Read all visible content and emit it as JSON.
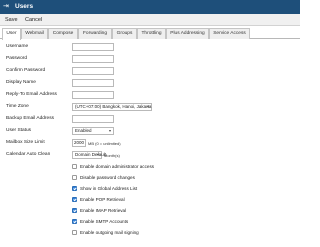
{
  "window": {
    "title": "Users",
    "icon": "collapse-panel-icon"
  },
  "toolbar": {
    "save_label": "Save",
    "cancel_label": "Cancel"
  },
  "tabs": [
    {
      "label": "User",
      "active": true
    },
    {
      "label": "Webmail"
    },
    {
      "label": "Compose"
    },
    {
      "label": "Forwarding"
    },
    {
      "label": "Groups"
    },
    {
      "label": "Throttling"
    },
    {
      "label": "Plus Addressing"
    },
    {
      "label": "Service Access"
    }
  ],
  "form": {
    "username": {
      "label": "Username",
      "value": ""
    },
    "password": {
      "label": "Password",
      "value": ""
    },
    "confirm_password": {
      "label": "Confirm Password",
      "value": ""
    },
    "display_name": {
      "label": "Display Name",
      "value": ""
    },
    "reply_to": {
      "label": "Reply-To Email Address",
      "value": ""
    },
    "time_zone": {
      "label": "Time Zone",
      "value": "(UTC+07:00) Bangkok, Hanoi, Jakarta"
    },
    "backup_email": {
      "label": "Backup Email Address",
      "value": ""
    },
    "user_status": {
      "label": "User Status",
      "value": "Enabled"
    },
    "mailbox_size": {
      "label": "Mailbox Size Limit",
      "value": "2000",
      "unit_hint": "MB  (0 = unlimited)"
    },
    "calendar_clean": {
      "label": "Calendar Auto Clean",
      "value": "Domain Default",
      "unit": "Month(s)"
    }
  },
  "options": [
    {
      "label": "Enable domain administrator access",
      "checked": false
    },
    {
      "label": "Disable password changes",
      "checked": false
    },
    {
      "label": "Show in Global Address List",
      "checked": true
    },
    {
      "label": "Enable POP Retrieval",
      "checked": true
    },
    {
      "label": "Enable IMAP Retrieval",
      "checked": true
    },
    {
      "label": "Enable SMTP Accounts",
      "checked": true
    },
    {
      "label": "Enable outgoing mail signing",
      "checked": false
    }
  ]
}
